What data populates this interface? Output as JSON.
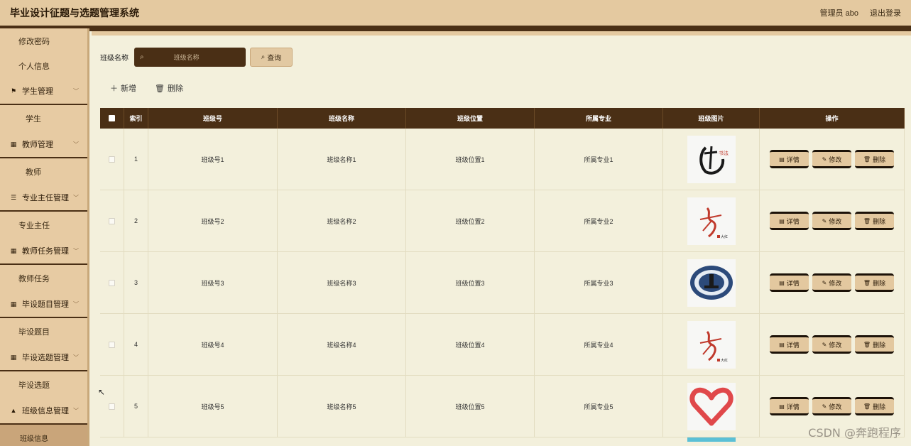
{
  "header": {
    "title": "毕业设计征题与选题管理系统",
    "admin": "管理员 abo",
    "logout": "退出登录"
  },
  "sidebar": {
    "change_password": "修改密码",
    "personal_info": "个人信息",
    "groups": [
      {
        "label": "学生管理",
        "icon": "flag-icon",
        "sub": "学生"
      },
      {
        "label": "教师管理",
        "icon": "grid-icon",
        "sub": "教师"
      },
      {
        "label": "专业主任管理",
        "icon": "list-icon",
        "sub": "专业主任"
      },
      {
        "label": "教师任务管理",
        "icon": "grid-icon",
        "sub": "教师任务"
      },
      {
        "label": "毕设题目管理",
        "icon": "grid-icon",
        "sub": "毕设题目"
      },
      {
        "label": "毕设选题管理",
        "icon": "grid-icon",
        "sub": "毕设选题"
      },
      {
        "label": "班级信息管理",
        "icon": "person-icon",
        "sub": "班级信息"
      }
    ]
  },
  "search": {
    "label": "班级名称",
    "placeholder": "班级名称",
    "query_button": "查询"
  },
  "actions": {
    "add": "新增",
    "delete": "删除"
  },
  "table": {
    "columns": [
      "索引",
      "班级号",
      "班级名称",
      "班级位置",
      "所属专业",
      "班级图片",
      "操作"
    ],
    "rows": [
      {
        "index": "1",
        "class_no": "班级号1",
        "class_name": "班级名称1",
        "class_pos": "班级位置1",
        "major": "所属专业1",
        "image": "calligraphy-logo"
      },
      {
        "index": "2",
        "class_no": "班级号2",
        "class_name": "班级名称2",
        "class_pos": "班级位置2",
        "major": "所属专业2",
        "image": "dancer-logo"
      },
      {
        "index": "3",
        "class_no": "班级号3",
        "class_name": "班级名称3",
        "class_pos": "班级位置3",
        "major": "所属专业3",
        "image": "emblem-logo"
      },
      {
        "index": "4",
        "class_no": "班级号4",
        "class_name": "班级名称4",
        "class_pos": "班级位置4",
        "major": "所属专业4",
        "image": "dancer-logo"
      },
      {
        "index": "5",
        "class_no": "班级号5",
        "class_name": "班级名称5",
        "class_pos": "班级位置5",
        "major": "所属专业5",
        "image": "heart-logo"
      }
    ],
    "row_buttons": {
      "detail": "详情",
      "edit": "修改",
      "delete": "删除"
    },
    "thumb_text": {
      "calligraphy": "书法",
      "dancer_tag": "大红"
    }
  },
  "watermark": "CSDN @奔跑程序",
  "colors": {
    "dark_brown": "#4a2f15",
    "tan": "#e4c9a0",
    "cream": "#f3f0dc"
  }
}
